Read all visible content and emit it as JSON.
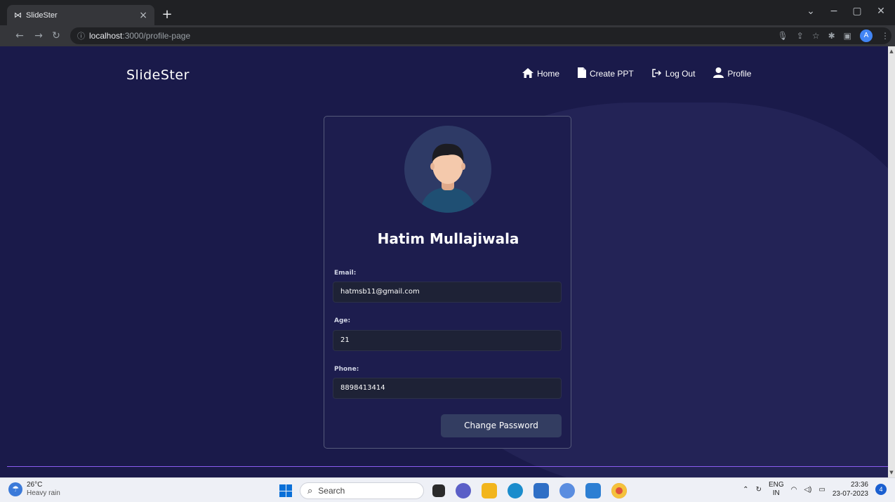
{
  "browser": {
    "tab_title": "SlideSter",
    "tab_favicon": "⋈",
    "url_host": "localhost",
    "url_path": ":3000/profile-page",
    "profile_initial": "A"
  },
  "site": {
    "brand": "SlideSter",
    "nav": [
      {
        "label": "Home",
        "icon": "home-icon"
      },
      {
        "label": "Create PPT",
        "icon": "file-icon"
      },
      {
        "label": "Log Out",
        "icon": "logout-icon"
      },
      {
        "label": "Profile",
        "icon": "user-icon"
      }
    ]
  },
  "profile": {
    "name": "Hatim Mullajiwala",
    "email_label": "Email:",
    "email": "hatmsb11@gmail.com",
    "age_label": "Age:",
    "age": "21",
    "phone_label": "Phone:",
    "phone": "8898413414",
    "change_password_label": "Change Password"
  },
  "taskbar": {
    "temperature": "26°C",
    "weather": "Heavy rain",
    "search_placeholder": "Search",
    "lang_top": "ENG",
    "lang_bottom": "IN",
    "time": "23:36",
    "date": "23-07-2023",
    "notification_count": "4"
  },
  "colors": {
    "page_bg": "#1a1a4a",
    "card_border": "#555a7a",
    "button_bg": "#333d61",
    "accent_line": "#8a5cf0"
  }
}
